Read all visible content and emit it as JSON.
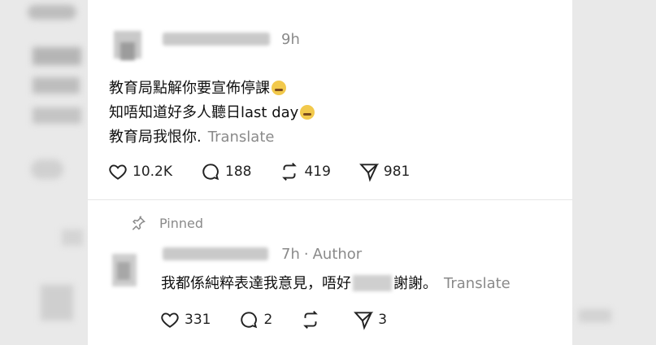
{
  "post": {
    "time": "9h",
    "lines": [
      "教育局點解你要宣佈停課",
      "知唔知道好多人聽日last day",
      "教育局我恨你."
    ],
    "translate": "Translate",
    "likes": "10.2K",
    "replies": "188",
    "reposts": "419",
    "shares": "981"
  },
  "pinned_label": "Pinned",
  "reply": {
    "time": "7h",
    "separator": "·",
    "role": "Author",
    "text_before": "我都係純粹表達我意見，唔好",
    "text_after": "謝謝。",
    "translate": "Translate",
    "likes": "331",
    "replies": "2",
    "shares": "3"
  },
  "icons": [
    "heart-icon",
    "comment-icon",
    "repost-icon",
    "share-icon",
    "pin-icon"
  ],
  "colors": {
    "muted": "#8a8a8a",
    "text": "#111111"
  }
}
